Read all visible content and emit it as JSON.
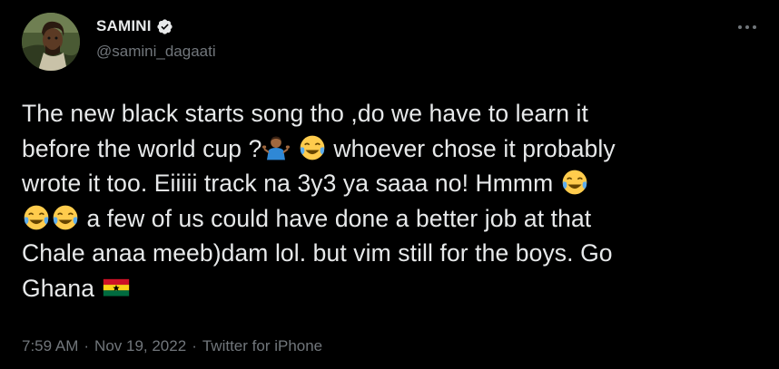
{
  "author": {
    "display_name": "SAMINI",
    "handle": "@samini_dagaati",
    "verified": true
  },
  "tweet": {
    "line1": "The new black starts song tho ,do we have to learn it",
    "line2a": "before the world cup ?",
    "line2b": "whoever chose it probably",
    "line3": "wrote it too. Eiiiii track na 3y3 ya saaa no! Hmmm",
    "line4": "a few of us could have done a better job at that",
    "line5": "Chale anaa meeb)dam lol. but vim still for the boys. Go",
    "line6": "Ghana"
  },
  "meta": {
    "time": "7:59 AM",
    "separator1": "·",
    "date": "Nov 19, 2022",
    "separator2": "·",
    "source": "Twitter for iPhone"
  },
  "colors": {
    "background": "#000000",
    "text": "#e7e9ea",
    "secondary": "#71767b",
    "verified": "#1d9bf0"
  },
  "icons": [
    "verified-badge-icon",
    "more-options-icon",
    "man-shrugging-emoji",
    "face-with-tears-of-joy-emoji",
    "ghana-flag-emoji"
  ]
}
